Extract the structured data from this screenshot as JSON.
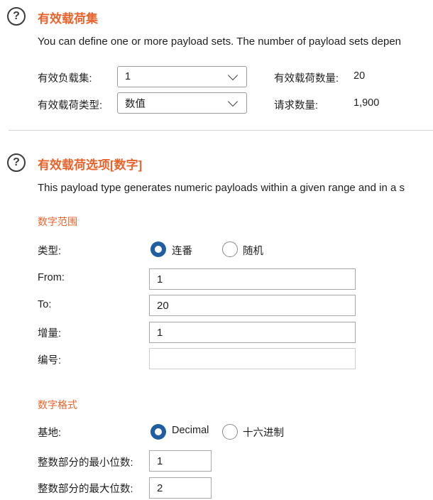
{
  "section1": {
    "help_icon": "?",
    "title": "有效载荷集",
    "description": "You can define one or more payload sets. The number of payload sets depen",
    "payload_set_label": "有效负载集:",
    "payload_set_value": "1",
    "payload_type_label": "有效载荷类型:",
    "payload_type_value": "数值",
    "payload_count_label": "有效载荷数量:",
    "payload_count_value": "20",
    "request_count_label": "请求数量:",
    "request_count_value": "1,900"
  },
  "section2": {
    "help_icon": "?",
    "title": "有效载荷选项[数字]",
    "description": "This payload type generates numeric payloads within a given range and in a s",
    "number_range": {
      "heading": "数字范围",
      "type_label": "类型:",
      "type_options": [
        "连番",
        "随机"
      ],
      "type_selected": "连番",
      "from_label": "From:",
      "from_value": "1",
      "to_label": "To:",
      "to_value": "20",
      "step_label": "增量:",
      "step_value": "1",
      "howmany_label": "编号:",
      "howmany_value": ""
    },
    "number_format": {
      "heading": "数字格式",
      "base_label": "基地:",
      "base_options": [
        "Decimal",
        "十六进制"
      ],
      "base_selected": "Decimal",
      "min_int_label": "整数部分的最小位数:",
      "min_int_value": "1",
      "max_int_label": "整数部分的最大位数:",
      "max_int_value": "2"
    }
  },
  "colors": {
    "accent": "#e8632b",
    "radio_selected": "#1f5fa0"
  }
}
